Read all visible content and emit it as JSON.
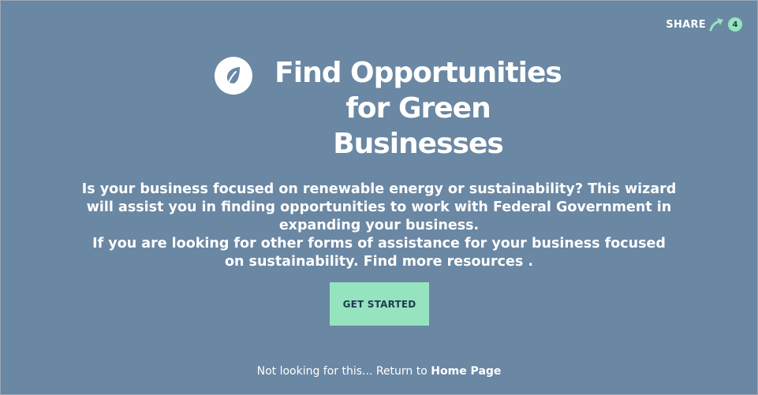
{
  "share": {
    "label": "SHARE",
    "count": "4",
    "icon": "share-arrow-icon",
    "accent": "#96e3bf"
  },
  "hero": {
    "icon": "leaf-icon",
    "title": "Find Opportunities for Green Businesses",
    "description_1": "Is your business focused on renewable energy or sustainability? This wizard will assist you in finding opportunities to work with Federal Government in expanding your business.",
    "description_2_prefix": "If you are looking for other forms of assistance for your business focused on sustainability. Find",
    "description_2_link": "more resources",
    "description_2_suffix": "."
  },
  "cta": {
    "label": "GET STARTED"
  },
  "footer": {
    "prefix": "Not looking for this... Return to",
    "link": "Home Page"
  },
  "colors": {
    "background": "#6a87a3",
    "button": "#96e3bf",
    "button_text": "#1f3a55"
  }
}
